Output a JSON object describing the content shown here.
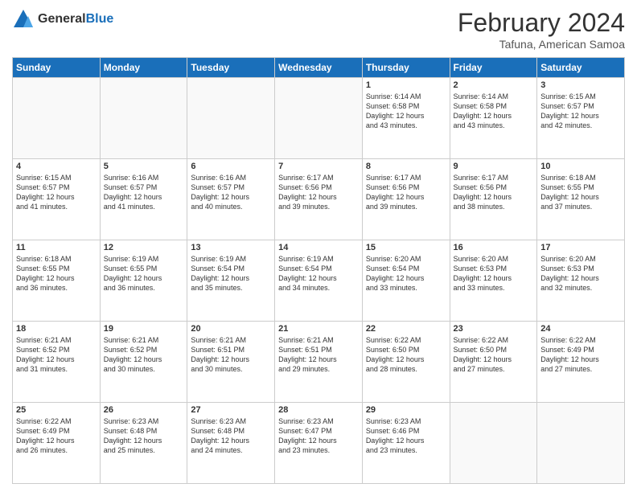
{
  "header": {
    "logo_general": "General",
    "logo_blue": "Blue",
    "month_title": "February 2024",
    "location": "Tafuna, American Samoa"
  },
  "days_of_week": [
    "Sunday",
    "Monday",
    "Tuesday",
    "Wednesday",
    "Thursday",
    "Friday",
    "Saturday"
  ],
  "weeks": [
    [
      {
        "day": "",
        "info": ""
      },
      {
        "day": "",
        "info": ""
      },
      {
        "day": "",
        "info": ""
      },
      {
        "day": "",
        "info": ""
      },
      {
        "day": "1",
        "info": "Sunrise: 6:14 AM\nSunset: 6:58 PM\nDaylight: 12 hours\nand 43 minutes."
      },
      {
        "day": "2",
        "info": "Sunrise: 6:14 AM\nSunset: 6:58 PM\nDaylight: 12 hours\nand 43 minutes."
      },
      {
        "day": "3",
        "info": "Sunrise: 6:15 AM\nSunset: 6:57 PM\nDaylight: 12 hours\nand 42 minutes."
      }
    ],
    [
      {
        "day": "4",
        "info": "Sunrise: 6:15 AM\nSunset: 6:57 PM\nDaylight: 12 hours\nand 41 minutes."
      },
      {
        "day": "5",
        "info": "Sunrise: 6:16 AM\nSunset: 6:57 PM\nDaylight: 12 hours\nand 41 minutes."
      },
      {
        "day": "6",
        "info": "Sunrise: 6:16 AM\nSunset: 6:57 PM\nDaylight: 12 hours\nand 40 minutes."
      },
      {
        "day": "7",
        "info": "Sunrise: 6:17 AM\nSunset: 6:56 PM\nDaylight: 12 hours\nand 39 minutes."
      },
      {
        "day": "8",
        "info": "Sunrise: 6:17 AM\nSunset: 6:56 PM\nDaylight: 12 hours\nand 39 minutes."
      },
      {
        "day": "9",
        "info": "Sunrise: 6:17 AM\nSunset: 6:56 PM\nDaylight: 12 hours\nand 38 minutes."
      },
      {
        "day": "10",
        "info": "Sunrise: 6:18 AM\nSunset: 6:55 PM\nDaylight: 12 hours\nand 37 minutes."
      }
    ],
    [
      {
        "day": "11",
        "info": "Sunrise: 6:18 AM\nSunset: 6:55 PM\nDaylight: 12 hours\nand 36 minutes."
      },
      {
        "day": "12",
        "info": "Sunrise: 6:19 AM\nSunset: 6:55 PM\nDaylight: 12 hours\nand 36 minutes."
      },
      {
        "day": "13",
        "info": "Sunrise: 6:19 AM\nSunset: 6:54 PM\nDaylight: 12 hours\nand 35 minutes."
      },
      {
        "day": "14",
        "info": "Sunrise: 6:19 AM\nSunset: 6:54 PM\nDaylight: 12 hours\nand 34 minutes."
      },
      {
        "day": "15",
        "info": "Sunrise: 6:20 AM\nSunset: 6:54 PM\nDaylight: 12 hours\nand 33 minutes."
      },
      {
        "day": "16",
        "info": "Sunrise: 6:20 AM\nSunset: 6:53 PM\nDaylight: 12 hours\nand 33 minutes."
      },
      {
        "day": "17",
        "info": "Sunrise: 6:20 AM\nSunset: 6:53 PM\nDaylight: 12 hours\nand 32 minutes."
      }
    ],
    [
      {
        "day": "18",
        "info": "Sunrise: 6:21 AM\nSunset: 6:52 PM\nDaylight: 12 hours\nand 31 minutes."
      },
      {
        "day": "19",
        "info": "Sunrise: 6:21 AM\nSunset: 6:52 PM\nDaylight: 12 hours\nand 30 minutes."
      },
      {
        "day": "20",
        "info": "Sunrise: 6:21 AM\nSunset: 6:51 PM\nDaylight: 12 hours\nand 30 minutes."
      },
      {
        "day": "21",
        "info": "Sunrise: 6:21 AM\nSunset: 6:51 PM\nDaylight: 12 hours\nand 29 minutes."
      },
      {
        "day": "22",
        "info": "Sunrise: 6:22 AM\nSunset: 6:50 PM\nDaylight: 12 hours\nand 28 minutes."
      },
      {
        "day": "23",
        "info": "Sunrise: 6:22 AM\nSunset: 6:50 PM\nDaylight: 12 hours\nand 27 minutes."
      },
      {
        "day": "24",
        "info": "Sunrise: 6:22 AM\nSunset: 6:49 PM\nDaylight: 12 hours\nand 27 minutes."
      }
    ],
    [
      {
        "day": "25",
        "info": "Sunrise: 6:22 AM\nSunset: 6:49 PM\nDaylight: 12 hours\nand 26 minutes."
      },
      {
        "day": "26",
        "info": "Sunrise: 6:23 AM\nSunset: 6:48 PM\nDaylight: 12 hours\nand 25 minutes."
      },
      {
        "day": "27",
        "info": "Sunrise: 6:23 AM\nSunset: 6:48 PM\nDaylight: 12 hours\nand 24 minutes."
      },
      {
        "day": "28",
        "info": "Sunrise: 6:23 AM\nSunset: 6:47 PM\nDaylight: 12 hours\nand 23 minutes."
      },
      {
        "day": "29",
        "info": "Sunrise: 6:23 AM\nSunset: 6:46 PM\nDaylight: 12 hours\nand 23 minutes."
      },
      {
        "day": "",
        "info": ""
      },
      {
        "day": "",
        "info": ""
      }
    ]
  ]
}
